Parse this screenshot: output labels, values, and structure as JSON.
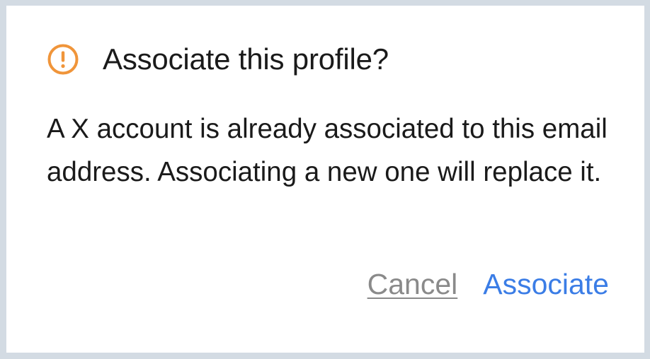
{
  "dialog": {
    "title": "Associate this profile?",
    "message": "A X account is already associated to this email address. Associating a new one will replace it.",
    "icon": "warning-circle-icon",
    "icon_color": "#f0953a",
    "actions": {
      "cancel_label": "Cancel",
      "confirm_label": "Associate"
    },
    "colors": {
      "confirm": "#3b7de6",
      "cancel": "#8a8a8a",
      "backdrop": "#d3dbe3"
    }
  }
}
